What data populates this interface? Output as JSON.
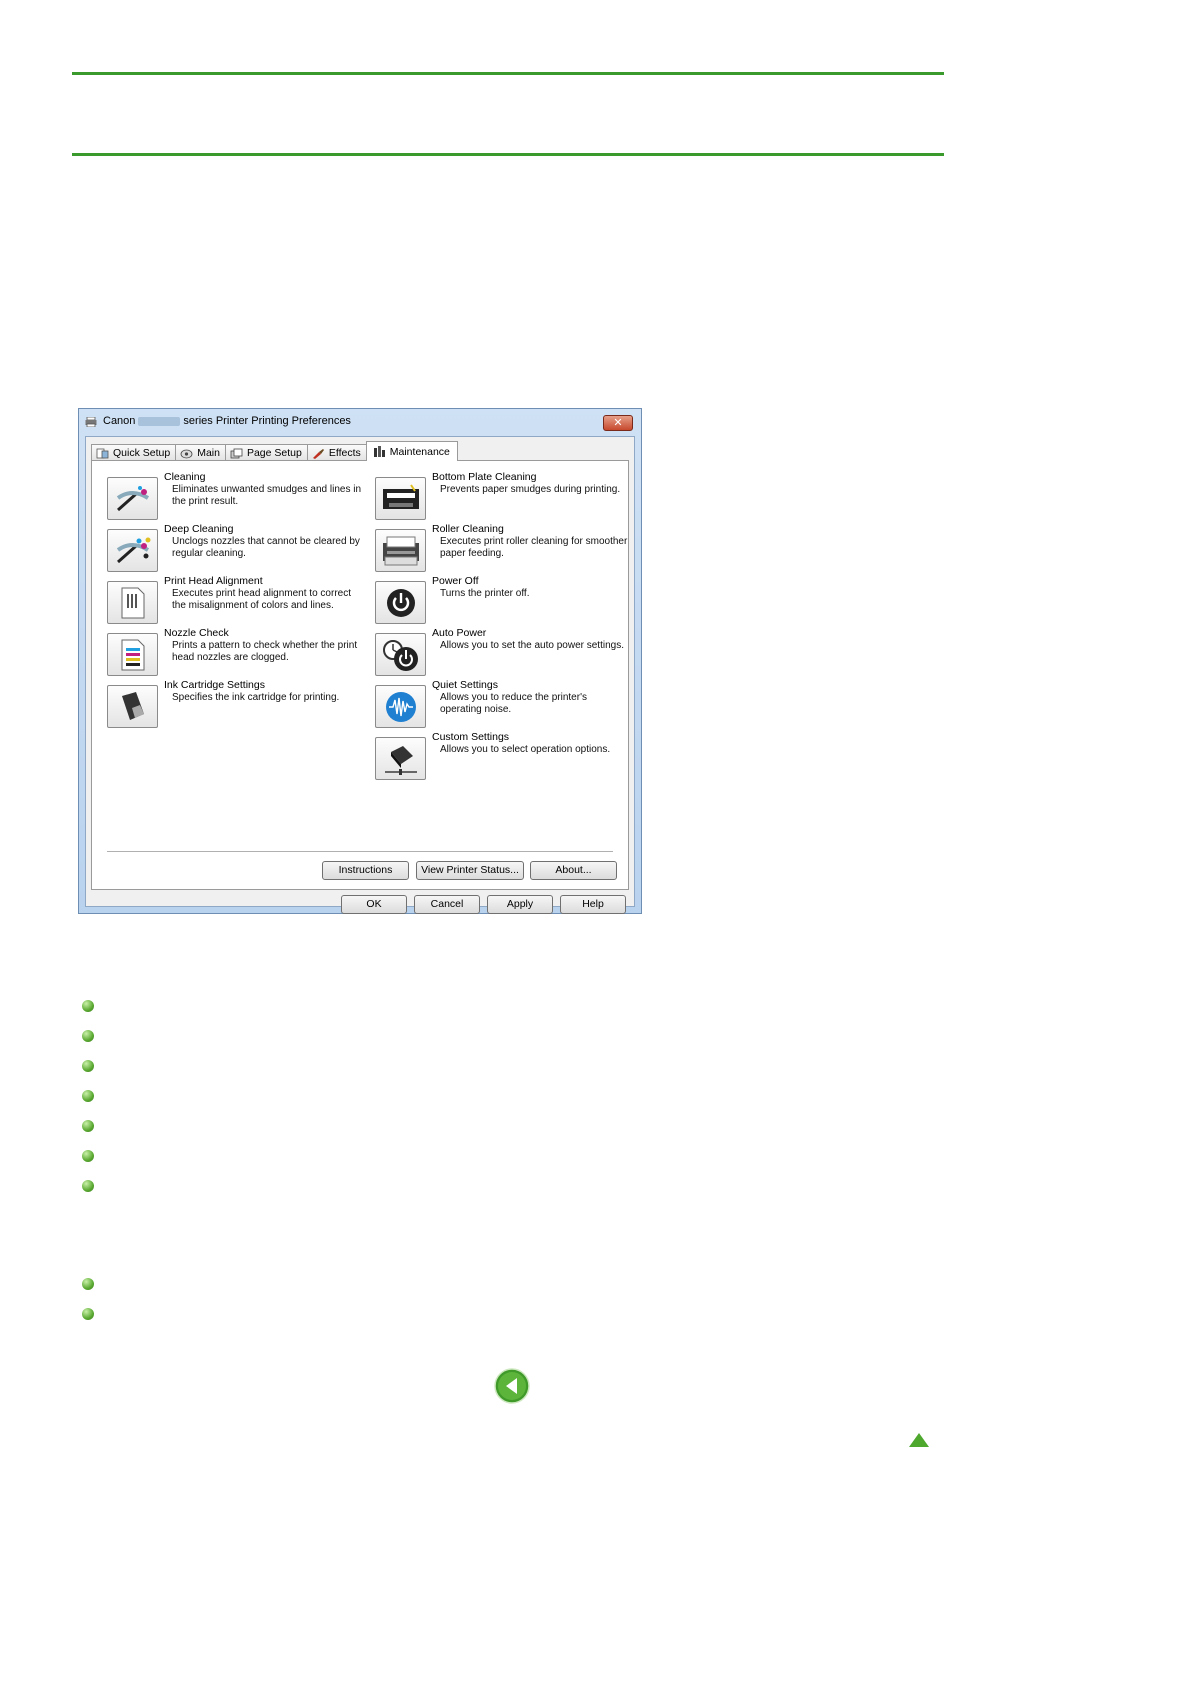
{
  "dialog": {
    "title_prefix": "Canon",
    "title_suffix": "series Printer Printing Preferences",
    "close_label": "✕",
    "tabs": [
      {
        "label": "Quick Setup",
        "icon": "quick-setup-icon"
      },
      {
        "label": "Main",
        "icon": "main-icon"
      },
      {
        "label": "Page Setup",
        "icon": "page-setup-icon"
      },
      {
        "label": "Effects",
        "icon": "effects-icon"
      },
      {
        "label": "Maintenance",
        "icon": "maintenance-icon",
        "active": true
      }
    ],
    "left_items": [
      {
        "title": "Cleaning",
        "desc": "Eliminates unwanted smudges and lines in the print result.",
        "icon": "cleaning-icon"
      },
      {
        "title": "Deep Cleaning",
        "desc": "Unclogs nozzles that cannot be cleared by regular cleaning.",
        "icon": "deep-cleaning-icon"
      },
      {
        "title": "Print Head Alignment",
        "desc": "Executes print head alignment to correct the misalignment of colors and lines.",
        "icon": "print-head-alignment-icon"
      },
      {
        "title": "Nozzle Check",
        "desc": "Prints a pattern to check whether the print head nozzles are clogged.",
        "icon": "nozzle-check-icon"
      },
      {
        "title": "Ink Cartridge Settings",
        "desc": "Specifies the ink cartridge for printing.",
        "icon": "ink-cartridge-icon"
      }
    ],
    "right_items": [
      {
        "title": "Bottom Plate Cleaning",
        "desc": "Prevents paper smudges during printing.",
        "icon": "bottom-plate-cleaning-icon"
      },
      {
        "title": "Roller Cleaning",
        "desc": "Executes print roller cleaning for smoother paper feeding.",
        "icon": "roller-cleaning-icon"
      },
      {
        "title": "Power Off",
        "desc": "Turns the printer off.",
        "icon": "power-off-icon"
      },
      {
        "title": "Auto Power",
        "desc": "Allows you to set the auto power settings.",
        "icon": "auto-power-icon"
      },
      {
        "title": "Quiet Settings",
        "desc": "Allows you to reduce the printer's operating noise.",
        "icon": "quiet-settings-icon"
      },
      {
        "title": "Custom Settings",
        "desc": "Allows you to select operation options.",
        "icon": "custom-settings-icon"
      }
    ],
    "panel_buttons": {
      "instructions": "Instructions",
      "view_status": "View Printer Status...",
      "about": "About..."
    },
    "footer_buttons": {
      "ok": "OK",
      "cancel": "Cancel",
      "apply": "Apply",
      "help": "Help"
    }
  },
  "navigation": {
    "prev_icon": "back-arrow-icon",
    "top_icon": "page-top-icon"
  },
  "colors": {
    "accent_green": "#3b9a2c",
    "titlebar_blue": "#b9d2ee"
  }
}
